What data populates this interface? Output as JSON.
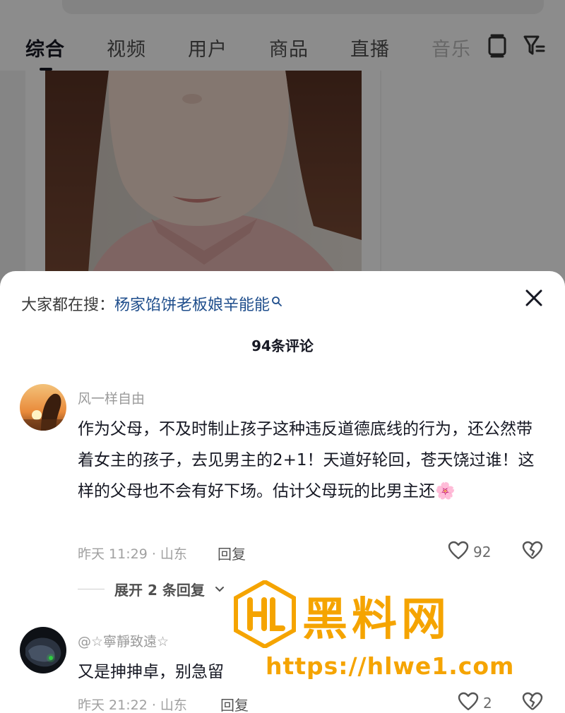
{
  "tabs": [
    {
      "label": "综合",
      "active": true
    },
    {
      "label": "视频",
      "active": false
    },
    {
      "label": "用户",
      "active": false
    },
    {
      "label": "商品",
      "active": false
    },
    {
      "label": "直播",
      "active": false
    },
    {
      "label": "音乐",
      "active": false
    }
  ],
  "tab_icons": [
    "tablet-icon",
    "filter-icon"
  ],
  "sheet": {
    "hot_search_prefix": "大家都在搜：",
    "hot_search_query": "杨家馅饼老板娘辛能能",
    "comment_count": "94条评论"
  },
  "comments": [
    {
      "username": "风一样自由",
      "text": "作为父母，不及时制止孩子这种违反道德底线的行为，还公然带着女主的孩子，去见男主的2+1！天道好轮回，苍天饶过谁！这样的父母也不会有好下场。估计父母玩的比男主还🌸",
      "time_location": "昨天 11:29 · 山东",
      "reply_label": "回复",
      "likes": "92",
      "expand_label": "展开 2 条回复"
    },
    {
      "username": "@☆寧靜致遠☆",
      "text": "又是抻抻卓，别急留",
      "time_location": "昨天 21:22 · 山东",
      "reply_label": "回复",
      "likes": "2"
    }
  ],
  "watermark": {
    "title": "黑料网",
    "url": "https://hlwe1.com",
    "logo": "HL"
  },
  "colors": {
    "accent_watermark": "#f5a400",
    "link": "#1f4e8c",
    "text_primary": "#161823",
    "text_secondary": "#9a9a9a"
  }
}
